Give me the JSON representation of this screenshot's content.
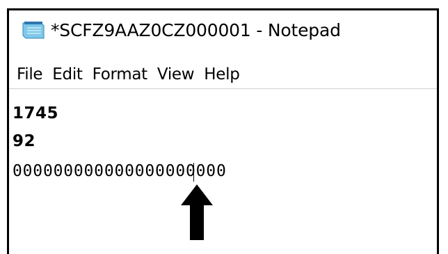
{
  "window": {
    "title": "*SCFZ9AAZ0CZ000001 - Notepad",
    "icon": "notepad-icon"
  },
  "menu": {
    "items": [
      "File",
      "Edit",
      "Format",
      "View",
      "Help"
    ]
  },
  "editor": {
    "lines": [
      "1745",
      "92",
      "000000000000000000000"
    ],
    "caret_after_char": 12
  },
  "annotation": {
    "icon": "arrow-up-icon",
    "color": "#000000"
  }
}
